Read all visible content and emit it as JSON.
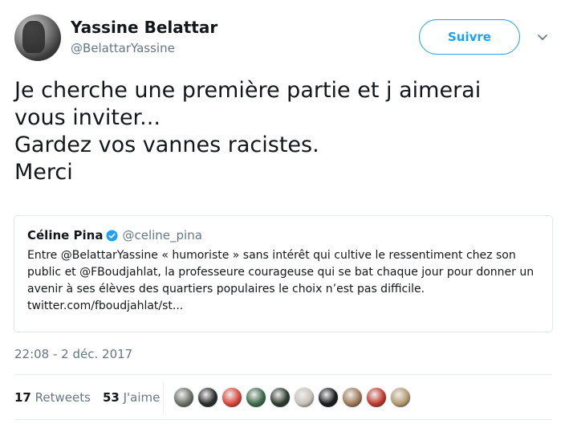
{
  "author": {
    "display_name": "Yassine Belattar",
    "handle": "@BelattarYassine"
  },
  "follow_button": {
    "label": "Suivre"
  },
  "more_icon": "chevron-down-icon",
  "tweet": {
    "lines": [
      "Je cherche une première partie et j aimerai",
      "vous inviter...",
      "Gardez vos vannes racistes.",
      "Merci"
    ]
  },
  "quoted_tweet": {
    "name": "Céline Pina",
    "verified_icon": "verified-badge-icon",
    "handle": "@celine_pina",
    "text": "Entre @BelattarYassine « humoriste » sans intérêt qui cultive le ressentiment chez son public et @FBoudjahlat, la professeure courageuse qui se bat chaque jour pour donner un avenir à ses élèves des quartiers populaires le choix n’est pas difficile. twitter.com/fboudjahlat/st..."
  },
  "timestamp": "22:08 - 2 déc. 2017",
  "stats": {
    "retweets_count": "17",
    "retweets_label": "Retweets",
    "likes_count": "53",
    "likes_label": "J'aime"
  },
  "colors": {
    "accent": "#1da1f2",
    "secondary_text": "#657786",
    "border": "#e1e8ed"
  },
  "liker_avatars": [
    {
      "name": "liker-avatar-1",
      "color": "#6b6f66"
    },
    {
      "name": "liker-avatar-2",
      "color": "#2b2b2b"
    },
    {
      "name": "liker-avatar-3",
      "color": "#d9463a"
    },
    {
      "name": "liker-avatar-4",
      "color": "#3d6a4a"
    },
    {
      "name": "liker-avatar-5",
      "color": "#2f3a2f"
    },
    {
      "name": "liker-avatar-6",
      "color": "#c8c2b8"
    },
    {
      "name": "liker-avatar-7",
      "color": "#1a1a1a"
    },
    {
      "name": "liker-avatar-8",
      "color": "#a07a55"
    },
    {
      "name": "liker-avatar-9",
      "color": "#c0392b"
    },
    {
      "name": "liker-avatar-10",
      "color": "#b59a6e"
    }
  ]
}
